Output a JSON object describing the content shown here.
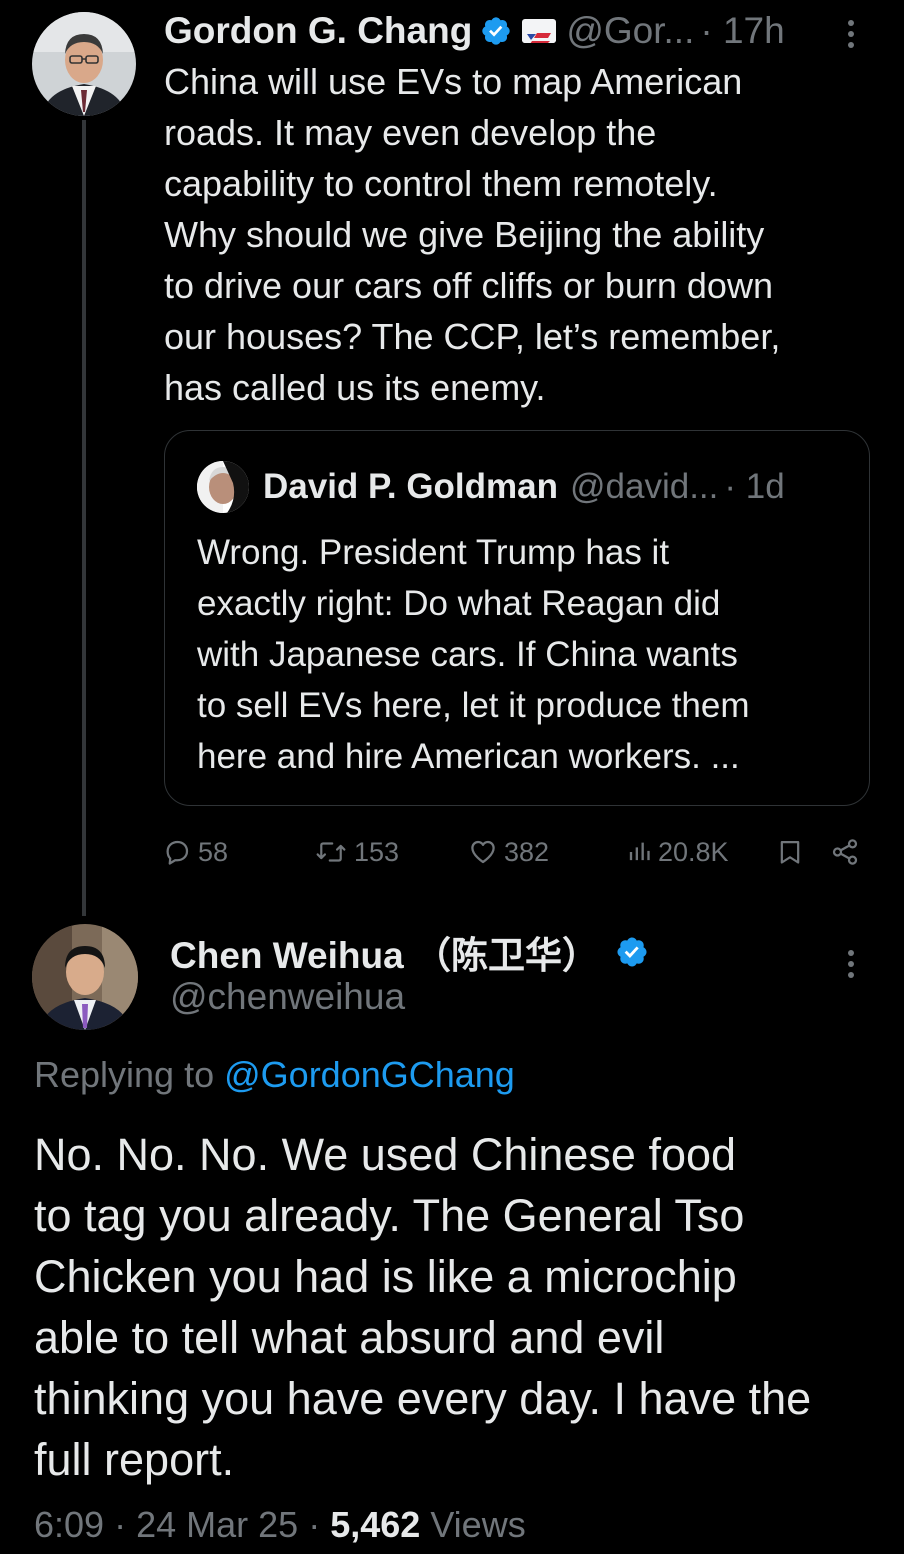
{
  "colors": {
    "background": "#000000",
    "text": "#e7e9ea",
    "muted": "#71767b",
    "accent": "#1d9bf0",
    "border": "#2f3336"
  },
  "parent_tweet": {
    "author_name": "Gordon G. Chang",
    "handle": "@Gor...",
    "time": "· 17h",
    "verified_icon": "verified-badge-icon",
    "affiliate_icon": "cpac-badge-icon",
    "text": "China will use EVs to map American\nroads. It may even develop the\ncapability to control them remotely.\nWhy should we give Beijing the ability\nto drive our cars off cliffs or burn down\nour houses? The CCP, let’s remember,\nhas called us its enemy.",
    "quoted_tweet": {
      "author_name": "David P. Goldman",
      "handle": "@david...",
      "time": "· 1d",
      "text": "Wrong. President Trump has it\nexactly right: Do what Reagan did\nwith Japanese cars. If China wants\nto sell EVs here, let it produce them\nhere and hire American workers. ..."
    },
    "actions": {
      "replies": "58",
      "reposts": "153",
      "likes": "382",
      "views": "20.8K"
    }
  },
  "reply_tweet": {
    "author_name": "Chen Weihua （陈卫华）",
    "handle": "@chenweihua",
    "replying_prefix": "Replying to",
    "replying_to": "@GordonGChang",
    "text": "No. No. No. We used Chinese food\nto tag you already. The General Tso\nChicken you had is like a microchip\nable to tell what absurd and evil\nthinking you have every day. I have the\nfull report.",
    "time": "6:09",
    "date": "24 Mar 25",
    "views_count": "5,462",
    "views_label": "Views"
  }
}
